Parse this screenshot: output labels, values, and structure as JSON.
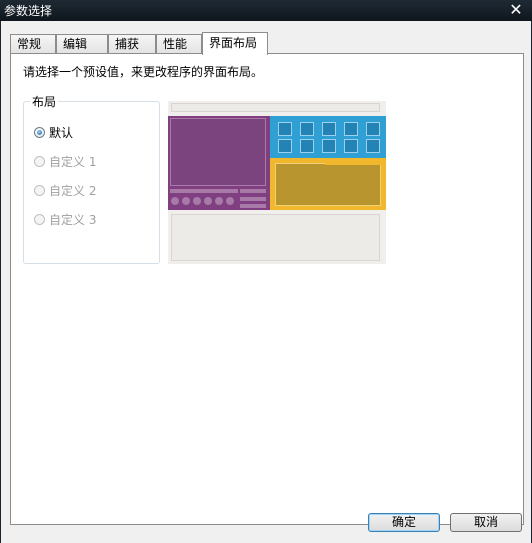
{
  "window": {
    "title": "参数选择",
    "close_glyph": "✕"
  },
  "tabs": [
    {
      "label": "常规",
      "active": false
    },
    {
      "label": "编辑",
      "active": false
    },
    {
      "label": "捕获",
      "active": false
    },
    {
      "label": "性能",
      "active": false
    },
    {
      "label": "界面布局",
      "active": true
    }
  ],
  "main": {
    "instruction": "请选择一个预设值，来更改程序的界面布局。"
  },
  "layout_group": {
    "legend": "布局",
    "options": [
      {
        "label": "默认",
        "checked": true,
        "enabled": true
      },
      {
        "label": "自定义 1",
        "checked": false,
        "enabled": false
      },
      {
        "label": "自定义 2",
        "checked": false,
        "enabled": false
      },
      {
        "label": "自定义 3",
        "checked": false,
        "enabled": false
      }
    ]
  },
  "preview_colors": {
    "purple": "#7f3f80",
    "blue": "#2f9fd4",
    "yellow": "#f2b82d",
    "gray": "#ecebe8"
  },
  "buttons": {
    "ok": "确定",
    "cancel": "取消"
  }
}
